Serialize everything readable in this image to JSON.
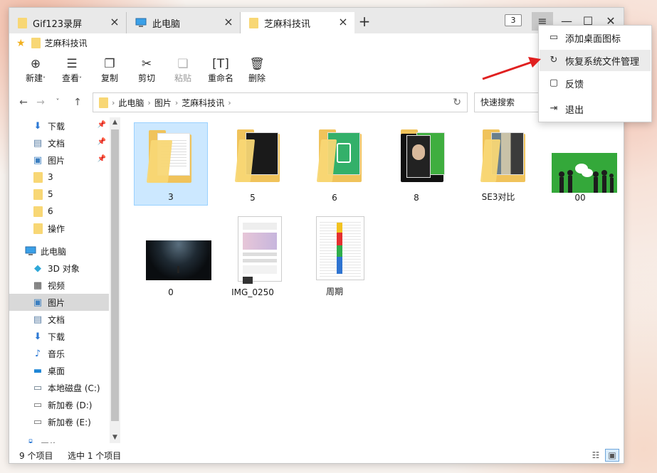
{
  "tabs": [
    {
      "label": "Gif123录屏",
      "icon": "folder-icon"
    },
    {
      "label": "此电脑",
      "icon": "computer-icon"
    },
    {
      "label": "芝麻科技讯",
      "icon": "folder-icon",
      "active": true
    }
  ],
  "tab_count_badge": "3",
  "quick_access": {
    "label": "芝麻科技讯"
  },
  "toolbar": {
    "new": "新建",
    "view": "查看",
    "copy": "复制",
    "cut": "剪切",
    "paste": "粘贴",
    "rename": "重命名",
    "delete": "删除"
  },
  "address": {
    "crumbs": [
      "此电脑",
      "图片",
      "芝麻科技讯"
    ],
    "search_placeholder": "快速搜索"
  },
  "sidebar": {
    "pinned": [
      {
        "label": "下载",
        "icon": "download-icon"
      },
      {
        "label": "文档",
        "icon": "document-icon"
      },
      {
        "label": "图片",
        "icon": "picture-icon"
      }
    ],
    "folders": [
      {
        "label": "3"
      },
      {
        "label": "5"
      },
      {
        "label": "6"
      },
      {
        "label": "操作"
      }
    ],
    "this_pc": {
      "label": "此电脑"
    },
    "pc_items": [
      {
        "label": "3D 对象",
        "icon": "3d-objects-icon"
      },
      {
        "label": "视频",
        "icon": "video-icon"
      },
      {
        "label": "图片",
        "icon": "picture-icon",
        "selected": true
      },
      {
        "label": "文档",
        "icon": "document-icon"
      },
      {
        "label": "下载",
        "icon": "download-icon"
      },
      {
        "label": "音乐",
        "icon": "music-icon"
      },
      {
        "label": "桌面",
        "icon": "desktop-icon"
      },
      {
        "label": "本地磁盘 (C:)",
        "icon": "drive-c-icon"
      },
      {
        "label": "新加卷 (D:)",
        "icon": "drive-icon"
      },
      {
        "label": "新加卷 (E:)",
        "icon": "drive-icon"
      }
    ],
    "network": {
      "label": "网络"
    }
  },
  "files": [
    {
      "name": "3",
      "type": "folder",
      "selected": true
    },
    {
      "name": "5",
      "type": "folder"
    },
    {
      "name": "6",
      "type": "folder"
    },
    {
      "name": "8",
      "type": "folder"
    },
    {
      "name": "SE3对比",
      "type": "folder"
    },
    {
      "name": "00",
      "type": "image"
    },
    {
      "name": "0",
      "type": "image"
    },
    {
      "name": "IMG_0250",
      "type": "image"
    },
    {
      "name": "周期",
      "type": "image"
    }
  ],
  "status": {
    "item_count": "9 个项目",
    "selection": "选中 1 个项目"
  },
  "menu": {
    "items": [
      {
        "label": "添加桌面图标",
        "icon": "monitor-icon"
      },
      {
        "label": "恢复系统文件管理",
        "icon": "restore-icon"
      },
      {
        "label": "反馈",
        "icon": "feedback-icon"
      },
      {
        "label": "退出",
        "icon": "exit-icon"
      }
    ]
  },
  "colors": {
    "accent_selection": "#cce8ff",
    "folder_yellow": "#f8d775",
    "annotation_arrow": "#e02020"
  }
}
